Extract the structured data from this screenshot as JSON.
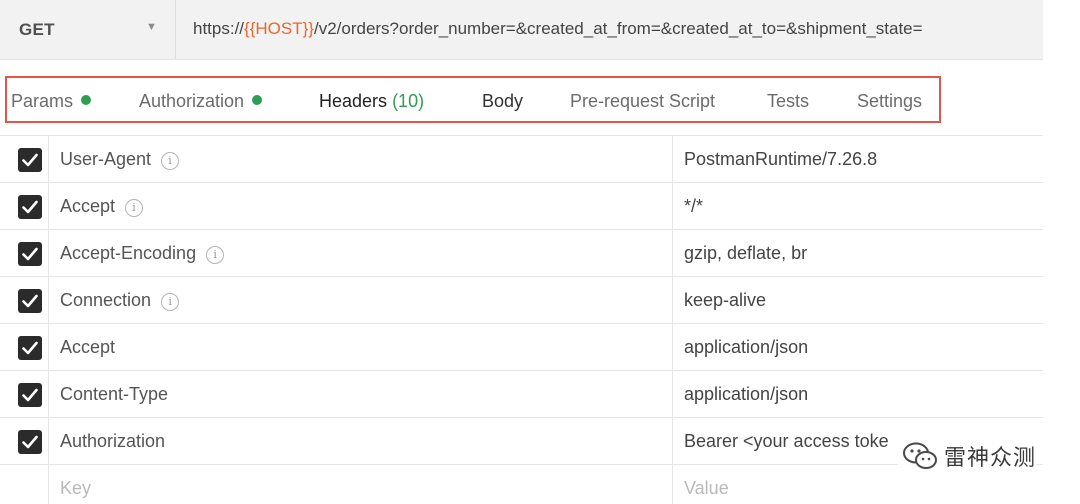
{
  "request": {
    "method": "GET",
    "url_prefix": "https://",
    "url_variable": "{{HOST}}",
    "url_suffix": "/v2/orders?order_number=&created_at_from=&created_at_to=&shipment_state="
  },
  "tabs": [
    {
      "label": "Params",
      "has_dot": true
    },
    {
      "label": "Authorization",
      "has_dot": true
    },
    {
      "label": "Headers",
      "count": "(10)",
      "active": true
    },
    {
      "label": "Body"
    },
    {
      "label": "Pre-request Script"
    },
    {
      "label": "Tests"
    },
    {
      "label": "Settings"
    }
  ],
  "headers": [
    {
      "key": "User-Agent",
      "info": true,
      "value": "PostmanRuntime/7.26.8",
      "checked": true
    },
    {
      "key": "Accept",
      "info": true,
      "value": "*/*",
      "checked": true
    },
    {
      "key": "Accept-Encoding",
      "info": true,
      "value": "gzip, deflate, br",
      "checked": true
    },
    {
      "key": "Connection",
      "info": true,
      "value": "keep-alive",
      "checked": true
    },
    {
      "key": "Accept",
      "info": false,
      "value": "application/json",
      "checked": true
    },
    {
      "key": "Content-Type",
      "info": false,
      "value": "application/json",
      "checked": true
    },
    {
      "key": "Authorization",
      "info": false,
      "value": "Bearer <your access toke",
      "checked": true
    }
  ],
  "new_row": {
    "key_placeholder": "Key",
    "value_placeholder": "Value"
  },
  "watermark": {
    "text": "雷神众测"
  },
  "icons": {
    "info": "info-icon",
    "check": "check-icon",
    "caret": "chevron-down-icon",
    "watermark": "wechat-icon"
  },
  "colors": {
    "accent_green": "#2e9e52",
    "highlight_red": "#e2554b",
    "variable_orange": "#e8672e"
  }
}
